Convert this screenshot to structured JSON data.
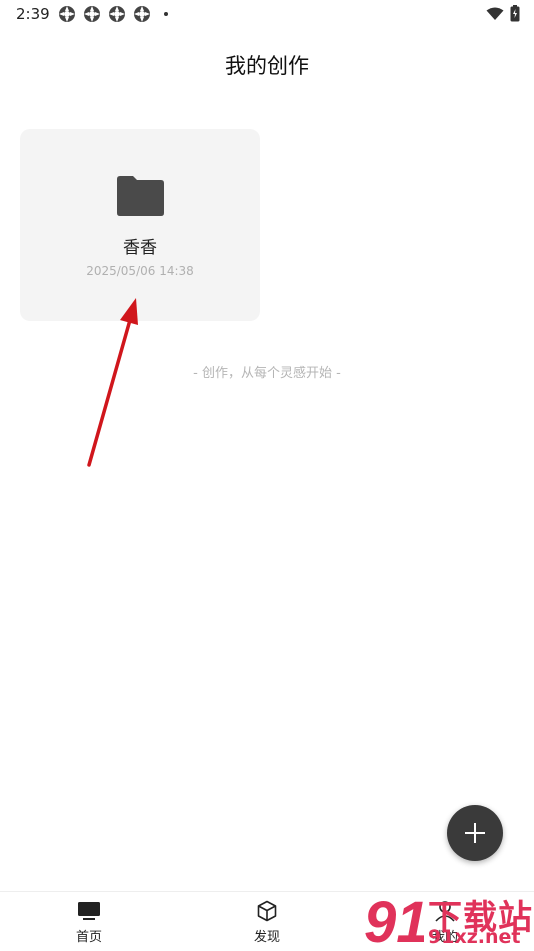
{
  "status_bar": {
    "time": "2:39"
  },
  "page": {
    "title": "我的创作"
  },
  "folder": {
    "name": "香香",
    "date": "2025/05/06 14:38"
  },
  "hint": "- 创作，从每个灵感开始 -",
  "bottom_nav": {
    "items": [
      {
        "label": "首页",
        "icon": "monitor-icon"
      },
      {
        "label": "发现",
        "icon": "cube-icon"
      },
      {
        "label": "我的",
        "icon": "profile-icon"
      }
    ]
  },
  "watermark": {
    "logo": "91",
    "title": "下载站",
    "domain": "91xz.net"
  },
  "colors": {
    "annotation_arrow": "#d0161c",
    "fab": "#3a3a3a",
    "watermark": "#e0325a"
  }
}
